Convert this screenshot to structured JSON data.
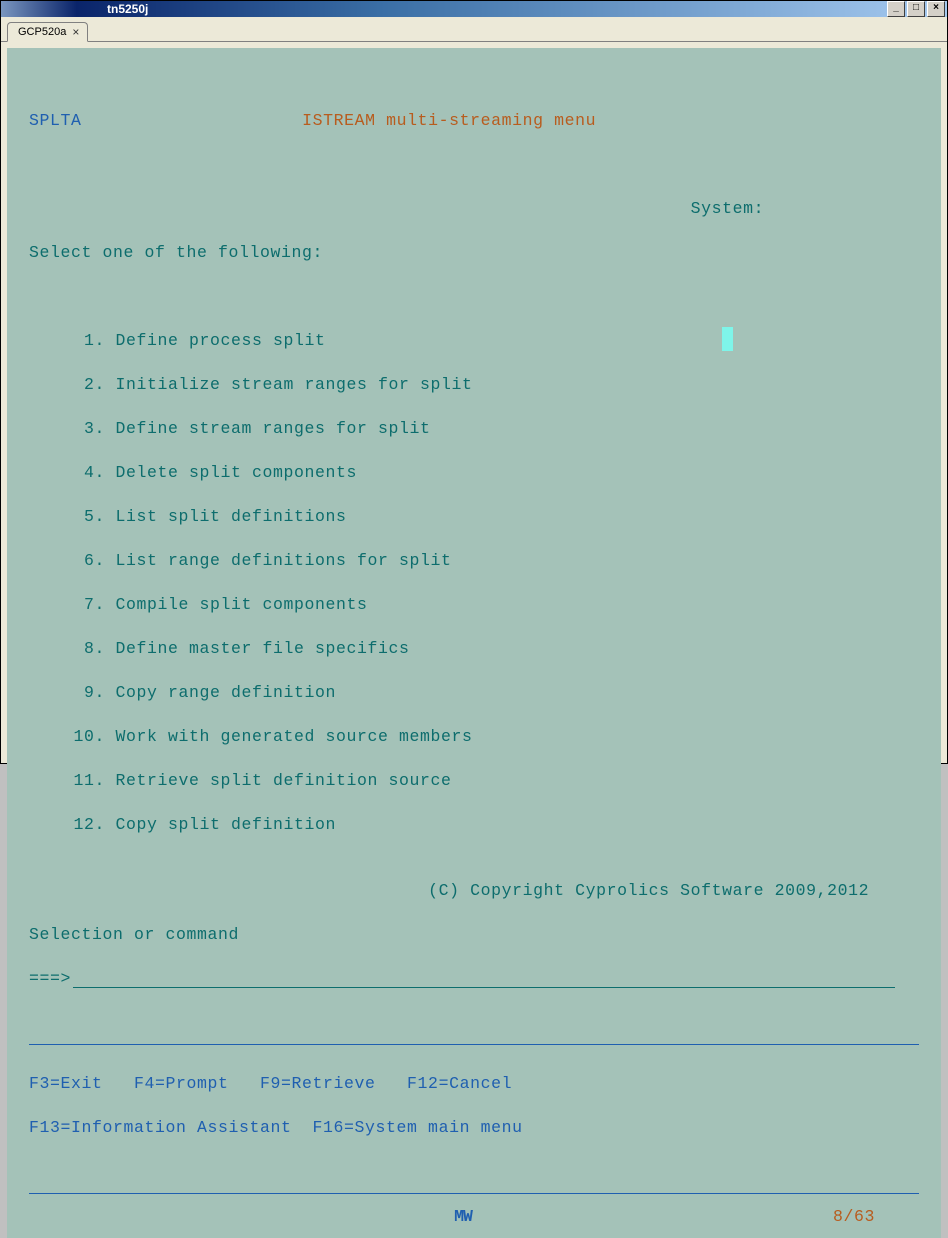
{
  "window": {
    "title": "tn5250j"
  },
  "tab": {
    "label": "GCP520a"
  },
  "screen": {
    "menu_id": "SPLTA",
    "title": "ISTREAM multi-streaming menu",
    "system_label": "System:",
    "prompt": "Select one of the following:",
    "items": [
      {
        "num": "1",
        "label": "Define process split"
      },
      {
        "num": "2",
        "label": "Initialize stream ranges for split"
      },
      {
        "num": "3",
        "label": "Define stream ranges for split"
      },
      {
        "num": "4",
        "label": "Delete split components"
      },
      {
        "num": "5",
        "label": "List split definitions"
      },
      {
        "num": "6",
        "label": "List range definitions for split"
      },
      {
        "num": "7",
        "label": "Compile split components"
      },
      {
        "num": "8",
        "label": "Define master file specifics"
      },
      {
        "num": "9",
        "label": "Copy range definition"
      },
      {
        "num": "10",
        "label": "Work with generated source members"
      },
      {
        "num": "11",
        "label": "Retrieve split definition source"
      },
      {
        "num": "12",
        "label": "Copy split definition"
      }
    ],
    "copyright": "(C) Copyright Cyprolics Software 2009,2012",
    "selection_label": "Selection or command",
    "cmd_prompt": "===>",
    "fkeys_line1": "F3=Exit   F4=Prompt   F9=Retrieve   F12=Cancel",
    "fkeys_line2": "F13=Information Assistant  F16=System main menu",
    "status_mode": "MW",
    "status_pos": "8/63"
  }
}
